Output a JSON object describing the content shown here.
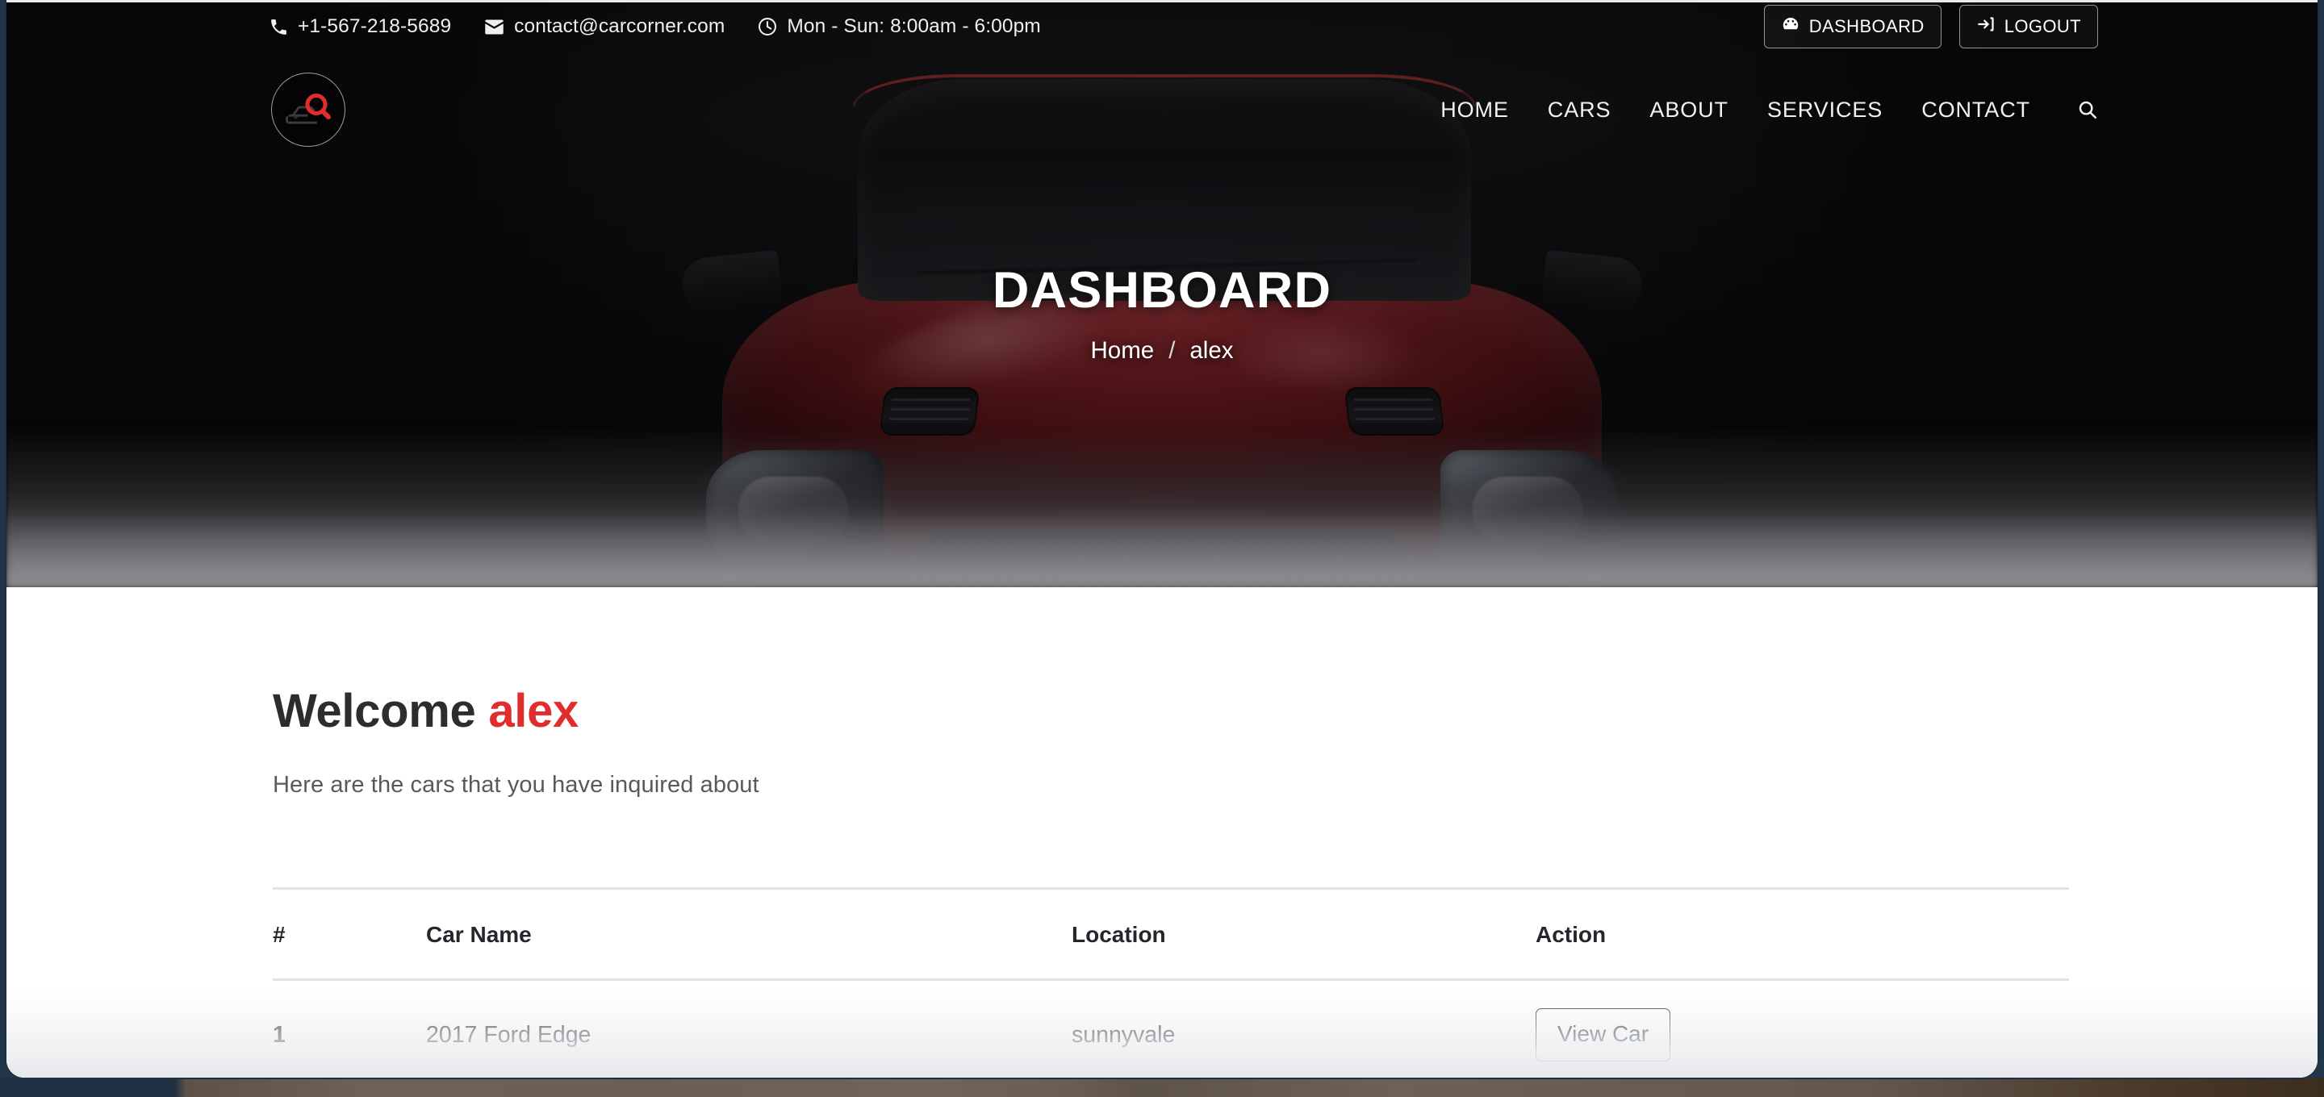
{
  "topbar": {
    "phone": "+1-567-218-5689",
    "email": "contact@carcorner.com",
    "hours": "Mon - Sun: 8:00am - 6:00pm",
    "dashboard_button": "DASHBOARD",
    "logout_button": "LOGOUT"
  },
  "nav": {
    "logo_alt": "Car Corner",
    "items": [
      {
        "label": "HOME"
      },
      {
        "label": "CARS"
      },
      {
        "label": "ABOUT"
      },
      {
        "label": "SERVICES"
      },
      {
        "label": "CONTACT"
      }
    ]
  },
  "hero": {
    "title": "DASHBOARD",
    "breadcrumb_home": "Home",
    "breadcrumb_sep": "/",
    "breadcrumb_current": "alex"
  },
  "main": {
    "welcome_prefix": "Welcome",
    "welcome_user": "alex",
    "subtitle": "Here are the cars that you have inquired about",
    "table": {
      "columns": [
        "#",
        "Car Name",
        "Location",
        "Action"
      ],
      "rows": [
        {
          "index": "1",
          "car_name": "2017 Ford Edge",
          "location": "sunnyvale",
          "action_label": "View Car"
        }
      ]
    }
  },
  "colors": {
    "accent_red": "#e02d2d",
    "hero_dark": "#0b0b0c",
    "text_dark": "#2d2d2d",
    "table_border": "#dfe3e8"
  }
}
